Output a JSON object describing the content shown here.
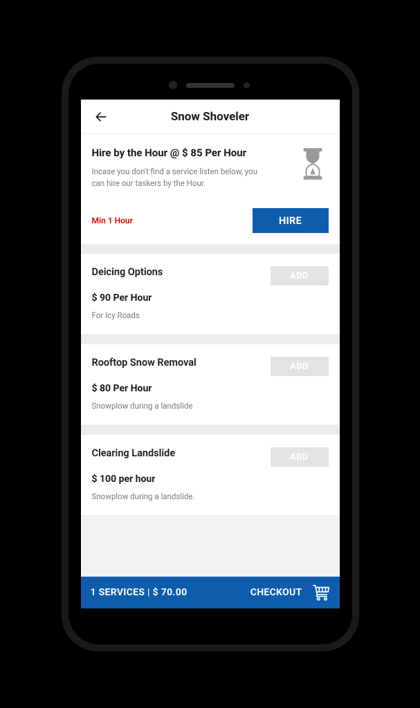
{
  "header": {
    "title": "Snow Shoveler"
  },
  "hire": {
    "title": "Hire by the Hour @  $ 85 Per Hour",
    "description": "Incase you don't find a service listen below, you can hire our taskers by the Hour.",
    "min_label": "Min 1 Hour",
    "button_label": "HIRE",
    "icon": "hourglass-icon"
  },
  "services": [
    {
      "title": "Deicing Options",
      "price": "$ 90 Per Hour",
      "description": "For Icy Roads",
      "button_label": "ADD"
    },
    {
      "title": "Rooftop Snow Removal",
      "price": "$ 80 Per Hour",
      "description": "Snowplow during a landslide",
      "button_label": "ADD"
    },
    {
      "title": "Clearing Landslide",
      "price": "$ 100 per hour",
      "description": "Snowplow during a landslide.",
      "button_label": "ADD"
    }
  ],
  "bottom_bar": {
    "summary": "1  SERVICES | $ 70.00",
    "checkout_label": "CHECKOUT",
    "cart_icon": "cart-icon"
  },
  "colors": {
    "brand": "#0e5dad",
    "danger": "#d80000"
  }
}
